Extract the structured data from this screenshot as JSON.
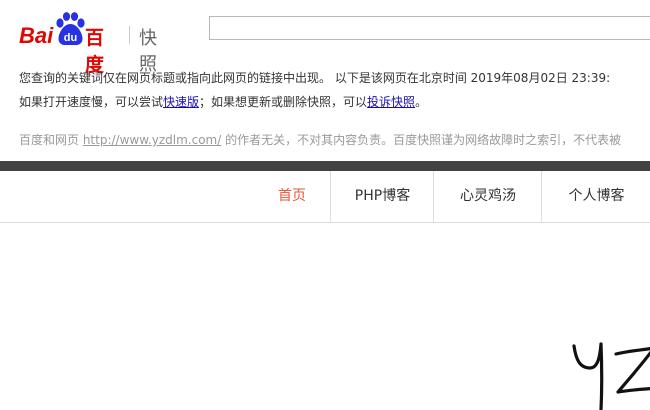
{
  "logo": {
    "bai": "Bai",
    "du": "du",
    "baidu_cn": "百度",
    "kuaizhao": "快照",
    "brand_red": "#e10601",
    "brand_blue": "#2932e1"
  },
  "search": {
    "value": ""
  },
  "notice": {
    "line1": "您查询的关键词仅在网页标题或指向此网页的链接中出现。   以下是该网页在北京时间 2019年08月02日 23:39:",
    "line2_prefix": "如果打开速度慢，可以尝试",
    "fast_link": "快速版",
    "line2_middle": "；如果想更新或删除快照，可以",
    "complain_link": "投诉快照",
    "line2_suffix": "。"
  },
  "disclaimer": {
    "prefix": "百度和网页 ",
    "url": "http://www.yzdlm.com/",
    "suffix": " 的作者无关，不对其内容负责。百度快照谨为网络故障时之索引，不代表被"
  },
  "nav": {
    "items": [
      "首页",
      "PHP博客",
      "心灵鸡汤",
      "个人博客"
    ],
    "active_color": "#e8573a"
  },
  "hero": {
    "handwriting_text": "yz"
  }
}
